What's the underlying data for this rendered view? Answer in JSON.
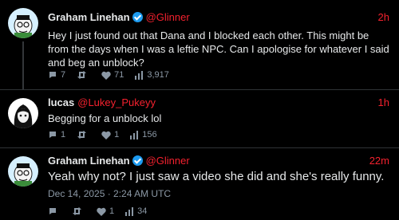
{
  "tweets": [
    {
      "name": "Graham Linehan",
      "handle": "@Glinner",
      "time": "2h",
      "text": "Hey I just found out that Dana and I blocked each other. This might be from the days when I was a leftie NPC. Can I apologise for whatever I said and beg an unblock?",
      "replies": "7",
      "retweets": "",
      "likes": "71",
      "views": "3,917",
      "verified": true
    },
    {
      "name": "lucas",
      "handle": "@Lukey_Pukeyy",
      "time": "1h",
      "text": "Begging for a unblock lol",
      "replies": "1",
      "retweets": "",
      "likes": "1",
      "views": "156",
      "verified": false
    },
    {
      "name": "Graham Linehan",
      "handle": "@Glinner",
      "time": "22m",
      "text": "Yeah why not? I just saw a video she did and she's really funny.",
      "date": "Dec 14, 2025 · 2:24 AM UTC",
      "replies": "",
      "retweets": "",
      "likes": "1",
      "views": "34",
      "verified": true
    }
  ],
  "colors": {
    "accent": "#f4212e",
    "muted": "#8b98a5",
    "verified": "#1d9bf0"
  },
  "icons": [
    "reply-icon",
    "retweet-icon",
    "like-icon",
    "views-icon",
    "verified-badge-icon"
  ]
}
